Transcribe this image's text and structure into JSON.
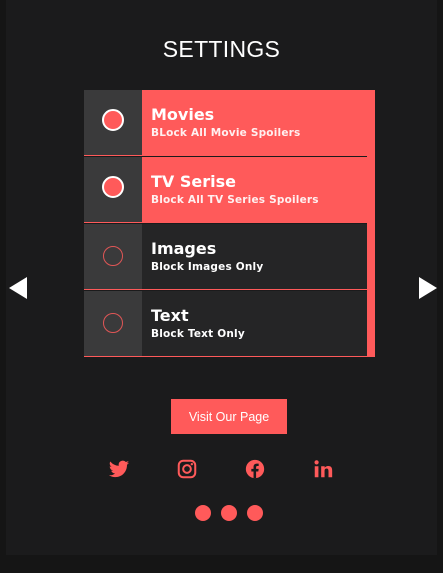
{
  "header": {
    "title": "SETTINGS"
  },
  "options": [
    {
      "title": "Movies",
      "subtitle": "BLock All Movie Spoilers",
      "selected": true
    },
    {
      "title": "TV Serise",
      "subtitle": "Block All TV Series Spoilers",
      "selected": true
    },
    {
      "title": "Images",
      "subtitle": "Block Images Only",
      "selected": false
    },
    {
      "title": "Text",
      "subtitle": "Block Text Only",
      "selected": false
    }
  ],
  "nav": {
    "prev_icon": "triangle-left-icon",
    "next_icon": "triangle-right-icon"
  },
  "cta": {
    "label": "Visit Our Page"
  },
  "social": [
    {
      "name": "twitter-icon"
    },
    {
      "name": "instagram-icon"
    },
    {
      "name": "facebook-icon"
    },
    {
      "name": "linkedin-icon"
    }
  ],
  "pager": {
    "count": 3
  },
  "colors": {
    "accent": "#ff5a5a",
    "background": "#1b1b1c",
    "radio_cell": "#3a3a3b",
    "row_dark": "#252526"
  }
}
